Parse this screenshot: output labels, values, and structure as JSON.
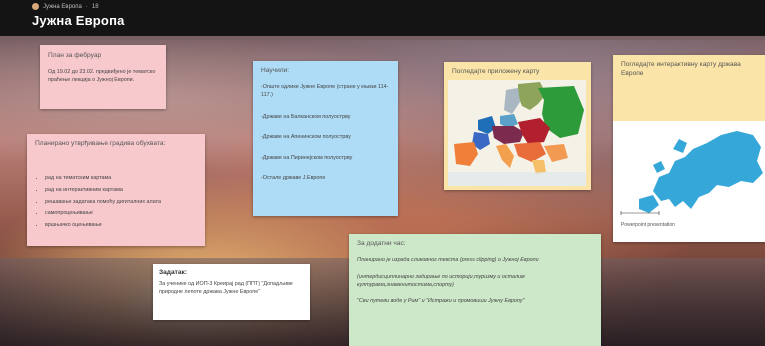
{
  "header": {
    "meta_author": "Јужна Европа",
    "meta_dot": "·",
    "meta_count": "18",
    "title": "Јужна Европа"
  },
  "cards": {
    "plan": {
      "title": "План за фебруар",
      "body": "Од 19.02 до 23.02. предвиђено је тематско праћење лекција о Јужној Европи."
    },
    "learned": {
      "title": "Научили:",
      "items": [
        "-Опште одлике Јужне Европе (стране у књизи 114-117.)",
        "-Државе на Балканском полуострву",
        "-Државе на Апенинском полуострву",
        "-Државе на Пиринејском полуострву",
        "-Остале државе Ј.Европе"
      ]
    },
    "map1": {
      "title": "Погледајте приложену карту"
    },
    "map2": {
      "title": "Погледајте интерактивну карту држава Европе",
      "caption": "Powerpoint presentation"
    },
    "reinforce": {
      "title": "Планирано утврђивање градива обухвата:",
      "items": [
        "рад на тематским картама",
        "рад на интерактивним картама",
        "решавање задатака помоћу дигиталних алата",
        "самопроцењивање",
        "вршњачко оцењивање"
      ]
    },
    "assignment": {
      "title": "Задатак:",
      "body": "За ученике од ИОП-3 Креирај рад (ППТ) \"Допадљиве природне лепоте држава Јужне Европе\""
    },
    "extra": {
      "title": "За додатни час:",
      "line1": "Планирано је израда сликовног текста (press clipping) о Јужној Европи",
      "line2": "(интердисциплинарно задирање по историји,туризму и осталим културама,знаменитостима,спорту)",
      "line3": "\"Сви путеви воде у Рим\" и \"Истражи и промовиши Јужну Европу\""
    }
  },
  "colors": {
    "pink": "#f7c9cd",
    "blue": "#aedbf5",
    "yellow": "#fbe4a8",
    "green": "#cde8c9",
    "header_bg": "#141414"
  }
}
